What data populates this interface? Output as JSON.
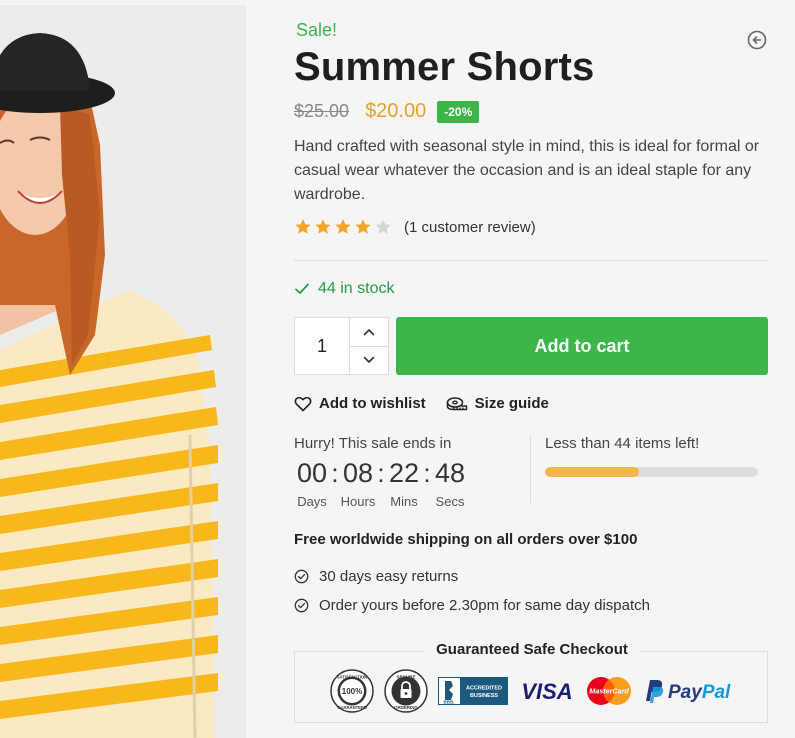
{
  "product": {
    "sale_label": "Sale!",
    "title": "Summer Shorts",
    "old_price": "$25.00",
    "new_price": "$20.00",
    "discount_badge": "-20%",
    "description": "Hand crafted with seasonal style in mind, this is ideal for formal or casual wear whatever the occasion and is an ideal staple for any wardrobe.",
    "rating": 4,
    "rating_max": 5,
    "review_text": "(1 customer review)",
    "stock_text": "44 in stock"
  },
  "purchase": {
    "quantity": "1",
    "add_to_cart_label": "Add to cart",
    "wishlist_label": "Add to wishlist",
    "size_guide_label": "Size guide"
  },
  "countdown": {
    "label": "Hurry! This sale ends in",
    "days": "00",
    "hours": "08",
    "mins": "22",
    "secs": "48",
    "days_caption": "Days",
    "hours_caption": "Hours",
    "mins_caption": "Mins",
    "secs_caption": "Secs",
    "stock_label": "Less than 44 items left!",
    "stock_progress": 0.44
  },
  "shipping": {
    "headline": "Free worldwide shipping on all orders over $100",
    "features": [
      "30 days easy returns",
      "Order yours before 2.30pm for same day dispatch"
    ]
  },
  "checkout": {
    "title": "Guaranteed Safe Checkout",
    "badges": {
      "satisfaction_text": "SATISFACTION",
      "satisfaction_pct": "100%",
      "satisfaction_sub": "GUARANTEED",
      "secure_text": "SECURE",
      "secure_sub": "ORDERING",
      "bbb_text": "BBB.",
      "bbb_accredited": "ACCREDITED",
      "bbb_business": "BUSINESS",
      "visa": "VISA",
      "mastercard": "MasterCard",
      "paypal_pay": "Pay",
      "paypal_pal": "Pal"
    }
  },
  "colors": {
    "accent_green": "#3cb64a",
    "price_gold": "#e4a32b",
    "star": "#f0a52b",
    "progress": "#f0b64c",
    "visa_blue": "#1a1f71",
    "paypal_dark": "#253b80",
    "paypal_light": "#179bd7"
  },
  "icons": {
    "back": "arrow-left-circle-icon",
    "check": "checkmark-icon",
    "heart": "heart-outline-icon",
    "ruler": "tape-measure-icon",
    "circle_check": "check-circle-icon"
  }
}
